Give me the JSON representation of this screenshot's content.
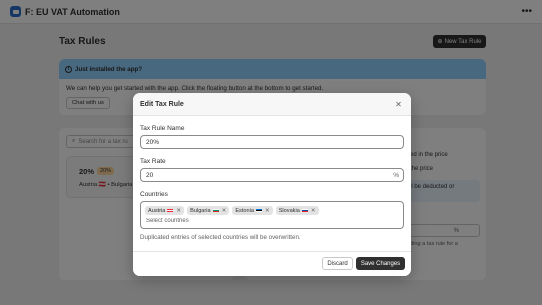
{
  "app": {
    "title": "F: EU VAT Automation",
    "menu_icon": "more-horizontal-icon"
  },
  "page": {
    "title": "Tax Rules",
    "new_rule_button": "New Tax Rule",
    "banner": {
      "title": "Just installed the app?",
      "text": "We can help you get started with the app. Click the floating button at the bottom to get started.",
      "button": "Chat with us"
    },
    "search_placeholder": "Search for a tax ru",
    "rule": {
      "rate": "20%",
      "badge": "20%",
      "countries": "Austria 🇦🇹 • Bulgaria"
    },
    "side": {
      "line1": "ed in the price",
      "line2": "the price",
      "note": "ll be deducted or",
      "input_suffix": "%",
      "line3": "ding a tax rule for a"
    }
  },
  "modal": {
    "title": "Edit Tax Rule",
    "name_label": "Tax Rule Name",
    "name_value": "20%",
    "rate_label": "Tax Rate",
    "rate_value": "20",
    "rate_suffix": "%",
    "countries_label": "Countries",
    "countries": [
      {
        "name": "Austria",
        "flag_colors": [
          "#ed2939",
          "#ffffff",
          "#ed2939"
        ]
      },
      {
        "name": "Bulgaria",
        "flag_colors": [
          "#ffffff",
          "#00966e",
          "#d62612"
        ]
      },
      {
        "name": "Estonia",
        "flag_colors": [
          "#0072ce",
          "#000000",
          "#ffffff"
        ]
      },
      {
        "name": "Slovakia",
        "flag_colors": [
          "#ffffff",
          "#0b4ea2",
          "#ee1c25"
        ]
      }
    ],
    "countries_placeholder": "Select countries",
    "help_text": "Duplicated entries of selected countries will be overwritten.",
    "discard_label": "Discard",
    "save_label": "Save Changes"
  }
}
